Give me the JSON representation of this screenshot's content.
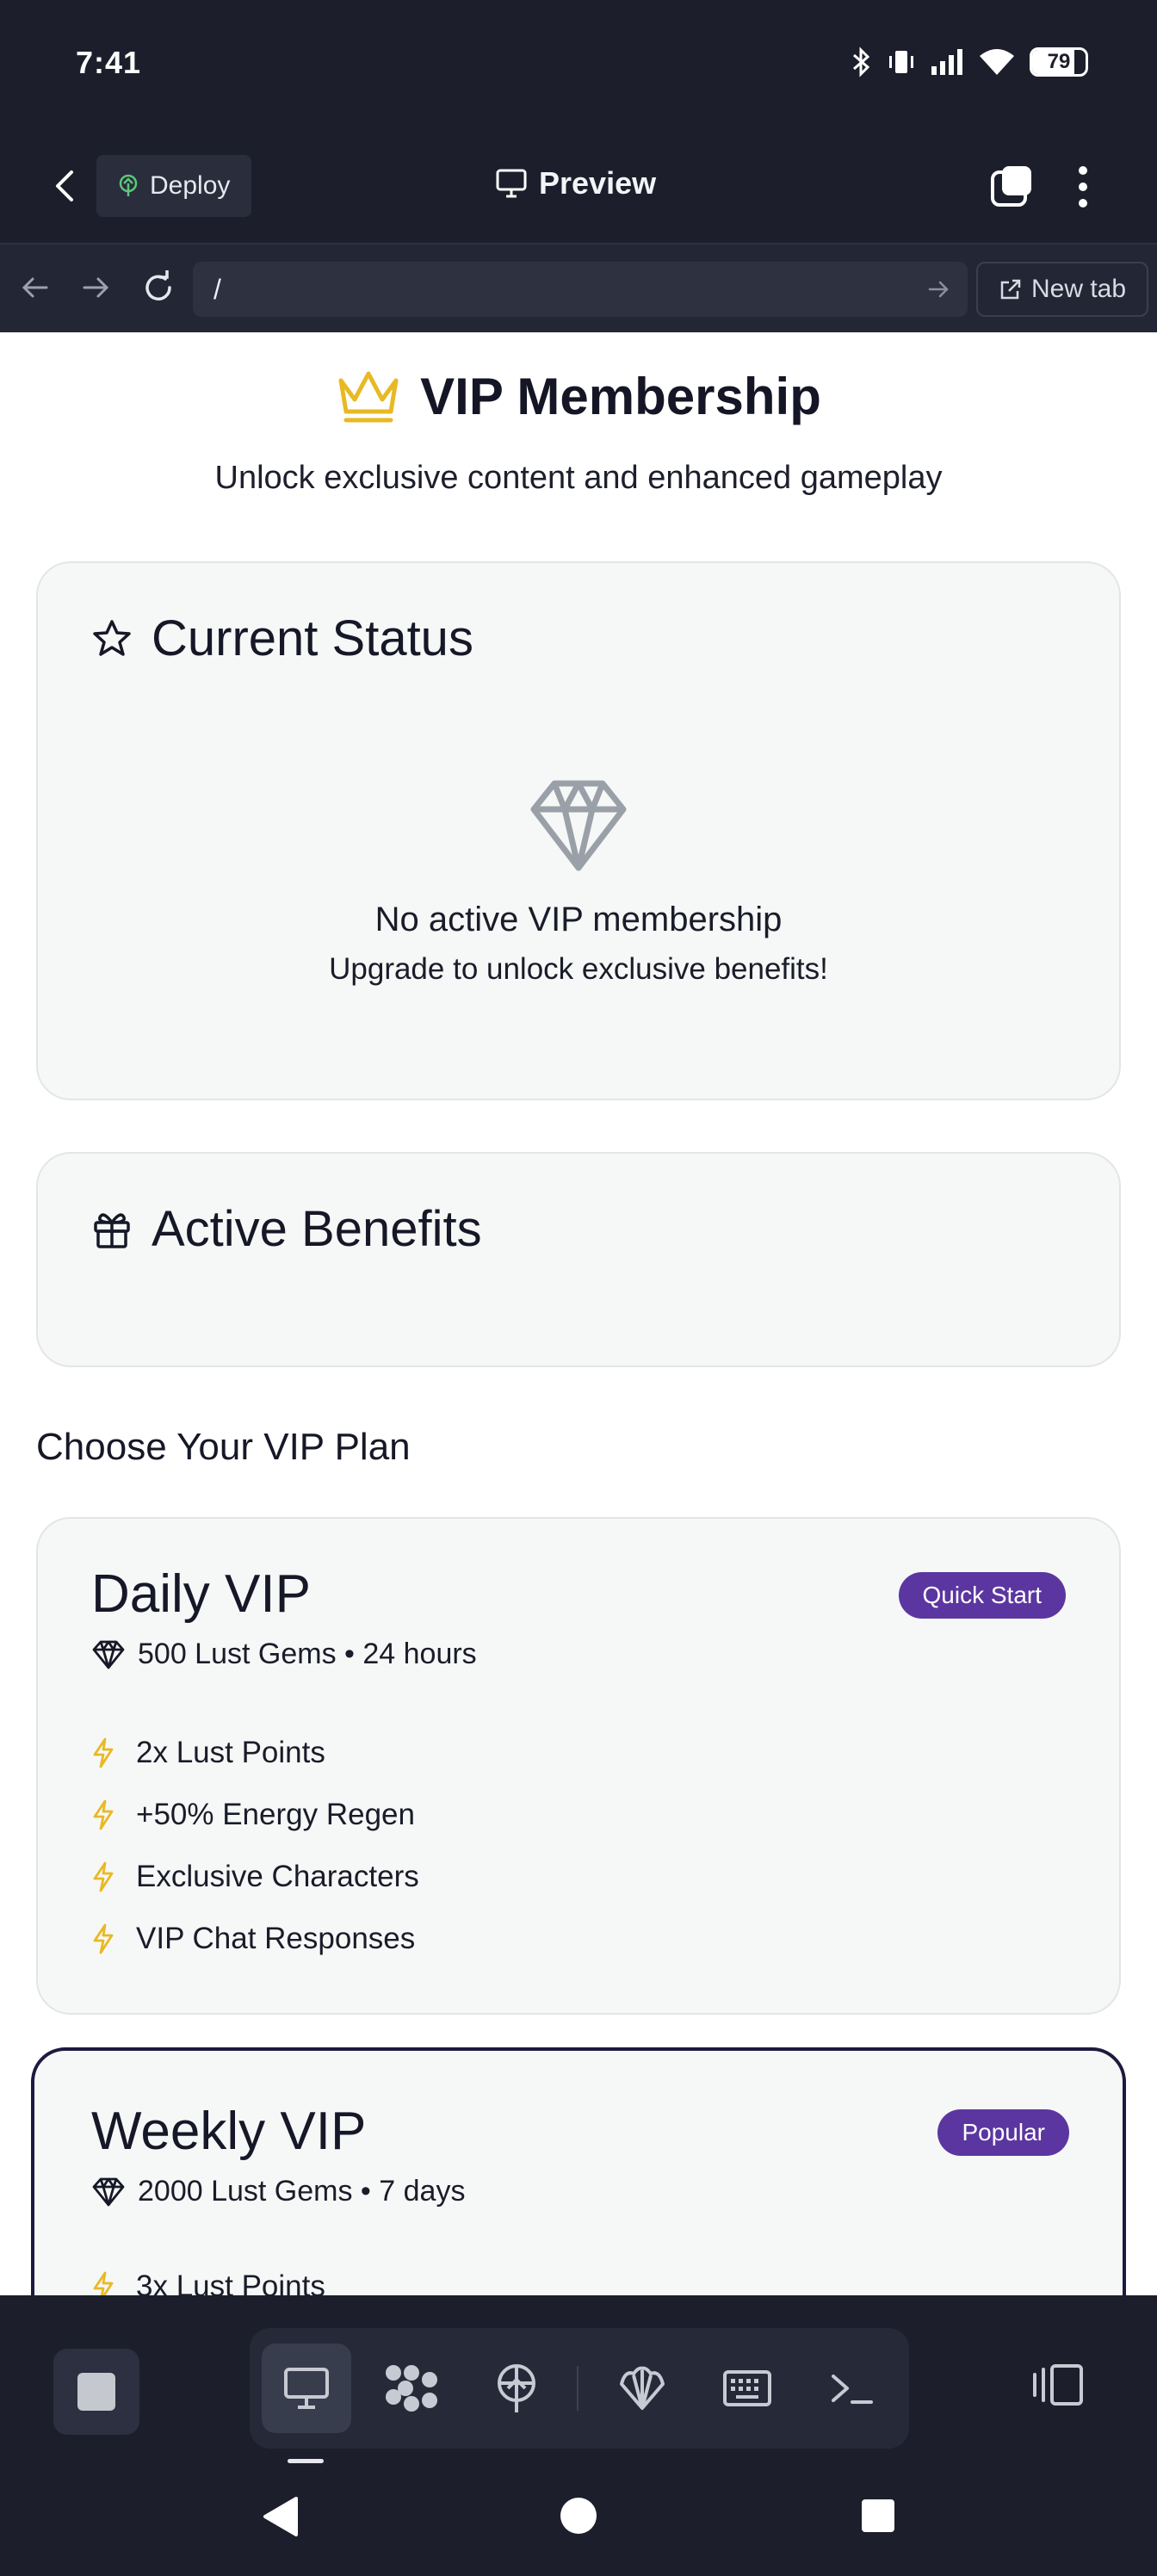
{
  "status_bar": {
    "time": "7:41",
    "battery_level": "79"
  },
  "app_header": {
    "deploy_label": "Deploy",
    "preview_label": "Preview"
  },
  "url_bar": {
    "path": "/",
    "new_tab_label": "New tab"
  },
  "page": {
    "title": "VIP Membership",
    "subtitle": "Unlock exclusive content and enhanced gameplay",
    "current_status": {
      "heading": "Current Status",
      "message": "No active VIP membership",
      "submessage": "Upgrade to unlock exclusive benefits!"
    },
    "active_benefits": {
      "heading": "Active Benefits"
    },
    "plans_heading": "Choose Your VIP Plan",
    "plans": [
      {
        "name": "Daily VIP",
        "badge": "Quick Start",
        "price": "500 Lust Gems • 24 hours",
        "features": [
          "2x Lust Points",
          "+50% Energy Regen",
          "Exclusive Characters",
          "VIP Chat Responses"
        ]
      },
      {
        "name": "Weekly VIP",
        "badge": "Popular",
        "price": "2000 Lust Gems • 7 days",
        "features": [
          "3x Lust Points"
        ]
      }
    ]
  },
  "colors": {
    "crown": "#e8b923",
    "bolt": "#e8b923",
    "badge": "#5b36a0",
    "diamond_gray": "#9aa0a8",
    "dark_bg": "#1c1f2b"
  }
}
